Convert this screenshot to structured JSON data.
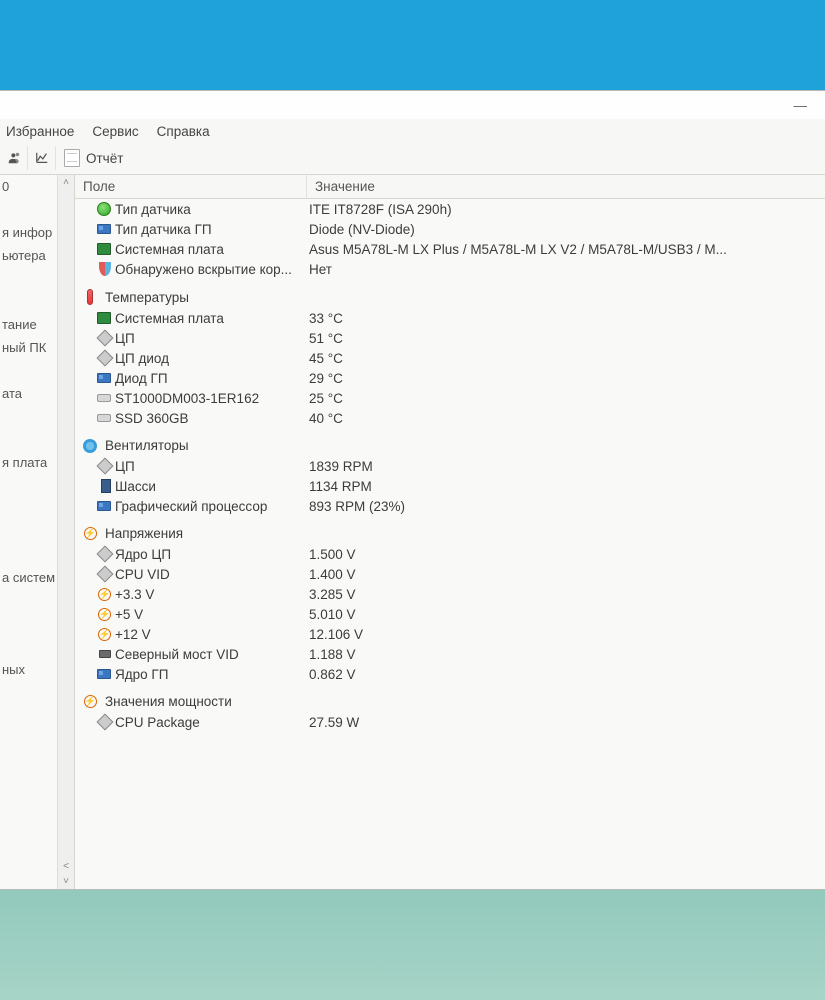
{
  "window": {
    "minimize": "—"
  },
  "menu": {
    "favorites": "Избранное",
    "service": "Сервис",
    "help": "Справка"
  },
  "toolbar": {
    "report": "Отчёт"
  },
  "tree": {
    "items": [
      "0",
      "",
      "я инфор",
      "ьютера",
      "",
      "",
      "тание",
      "ный ПК",
      "",
      "ата",
      "",
      "",
      "я плата",
      "",
      "",
      "",
      "",
      "а систем",
      "",
      "",
      "",
      "ных",
      "",
      ""
    ]
  },
  "list": {
    "header_field": "Поле",
    "header_value": "Значение",
    "top": [
      {
        "icon": "sensor",
        "label": "Тип датчика",
        "value": "ITE IT8728F  (ISA 290h)"
      },
      {
        "icon": "gpu",
        "label": "Тип датчика ГП",
        "value": "Diode  (NV-Diode)"
      },
      {
        "icon": "mb",
        "label": "Системная плата",
        "value": "Asus M5A78L-M LX Plus / M5A78L-M LX V2 / M5A78L-M/USB3 / M..."
      },
      {
        "icon": "shield",
        "label": "Обнаружено вскрытие кор...",
        "value": "Нет"
      }
    ],
    "sections": [
      {
        "icon": "therm",
        "title": "Температуры",
        "rows": [
          {
            "icon": "mb",
            "label": "Системная плата",
            "value": "33 °C"
          },
          {
            "icon": "chip",
            "label": "ЦП",
            "value": "51 °C"
          },
          {
            "icon": "chip",
            "label": "ЦП диод",
            "value": "45 °C"
          },
          {
            "icon": "gpu",
            "label": "Диод ГП",
            "value": "29 °C"
          },
          {
            "icon": "drive",
            "label": "ST1000DM003-1ER162",
            "value": "25 °C"
          },
          {
            "icon": "drive",
            "label": "SSD 360GB",
            "value": "40 °C"
          }
        ]
      },
      {
        "icon": "fan",
        "title": "Вентиляторы",
        "rows": [
          {
            "icon": "chip",
            "label": "ЦП",
            "value": "1839 RPM"
          },
          {
            "icon": "box",
            "label": "Шасси",
            "value": "1134 RPM"
          },
          {
            "icon": "gpu",
            "label": "Графический процессор",
            "value": "893 RPM  (23%)"
          }
        ]
      },
      {
        "icon": "volt",
        "title": "Напряжения",
        "rows": [
          {
            "icon": "chip",
            "label": "Ядро ЦП",
            "value": "1.500 V"
          },
          {
            "icon": "chip",
            "label": "CPU VID",
            "value": "1.400 V"
          },
          {
            "icon": "volt",
            "label": "+3.3 V",
            "value": "3.285 V"
          },
          {
            "icon": "volt",
            "label": "+5 V",
            "value": "5.010 V"
          },
          {
            "icon": "volt",
            "label": "+12 V",
            "value": "12.106 V"
          },
          {
            "icon": "chip2",
            "label": "Северный мост VID",
            "value": "1.188 V"
          },
          {
            "icon": "gpu",
            "label": "Ядро ГП",
            "value": "0.862 V"
          }
        ]
      },
      {
        "icon": "volt",
        "title": "Значения мощности",
        "rows": [
          {
            "icon": "chip",
            "label": "CPU Package",
            "value": "27.59 W"
          }
        ]
      }
    ]
  }
}
